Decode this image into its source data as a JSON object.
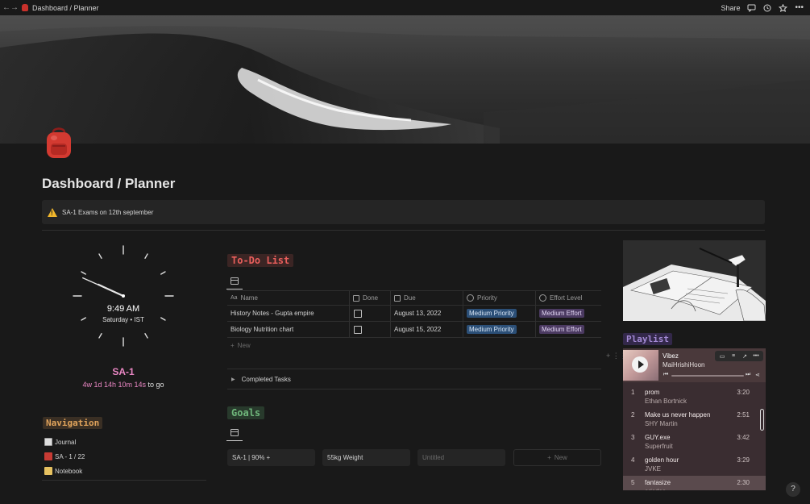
{
  "topbar": {
    "back_icon": "arrow-left-icon",
    "forward_icon": "arrow-right-icon",
    "breadcrumb": "Dashboard / Planner",
    "share_label": "Share",
    "comment_icon": "comment-icon",
    "history_icon": "clock-history-icon",
    "favorite_icon": "star-icon",
    "more_icon": "more-dots-icon"
  },
  "page": {
    "icon": "backpack-icon",
    "title": "Dashboard / Planner"
  },
  "callout": {
    "icon": "warning-icon",
    "text": "SA-1 Exams on 12th september"
  },
  "clock": {
    "time": "9:49 AM",
    "day": "Saturday • IST",
    "hour": 9,
    "minute": 49
  },
  "countdown": {
    "title": "SA-1",
    "remaining": "4w 1d 14h 10m 14s",
    "suffix": "to go"
  },
  "navigation": {
    "heading": "Navigation",
    "items": [
      {
        "label": "Journal",
        "icon": "journal-icon"
      },
      {
        "label": "SA - 1 / 22",
        "icon": "book-icon"
      },
      {
        "label": "Notebook",
        "icon": "notebook-icon"
      }
    ]
  },
  "todo": {
    "heading": "To-Do List",
    "columns": [
      "Name",
      "Done",
      "Due",
      "Priority",
      "Effort Level"
    ],
    "rows": [
      {
        "name": "History Notes - Gupta empire",
        "done": false,
        "due": "August 13, 2022",
        "priority": "Medium Priority",
        "effort": "Medium Effort"
      },
      {
        "name": "Biology Nutrition chart",
        "done": false,
        "due": "August 15, 2022",
        "priority": "Medium Priority",
        "effort": "Medium Effort"
      }
    ],
    "new_label": "New",
    "completed_label": "Completed Tasks"
  },
  "goals": {
    "heading": "Goals",
    "cards": [
      "SA-1 | 90% +",
      "55kg Weight",
      "Untitled"
    ],
    "new_label": "New"
  },
  "playlist": {
    "heading": "Playlist",
    "now_playing": {
      "title": "Vibez",
      "artist": "MaiHrishiHoon"
    },
    "tracks": [
      {
        "num": "1",
        "name": "prom",
        "artist": "Ethan Bortnick",
        "duration": "3:20"
      },
      {
        "num": "2",
        "name": "Make us never happen",
        "artist": "SHY Martin",
        "duration": "2:51"
      },
      {
        "num": "3",
        "name": "GUY.exe",
        "artist": "Superfruit",
        "duration": "3:42"
      },
      {
        "num": "4",
        "name": "golden hour",
        "artist": "JVKE",
        "duration": "3:29"
      },
      {
        "num": "5",
        "name": "fantasize",
        "artist": "ericdoa",
        "duration": "2:30"
      }
    ]
  },
  "help_label": "?"
}
